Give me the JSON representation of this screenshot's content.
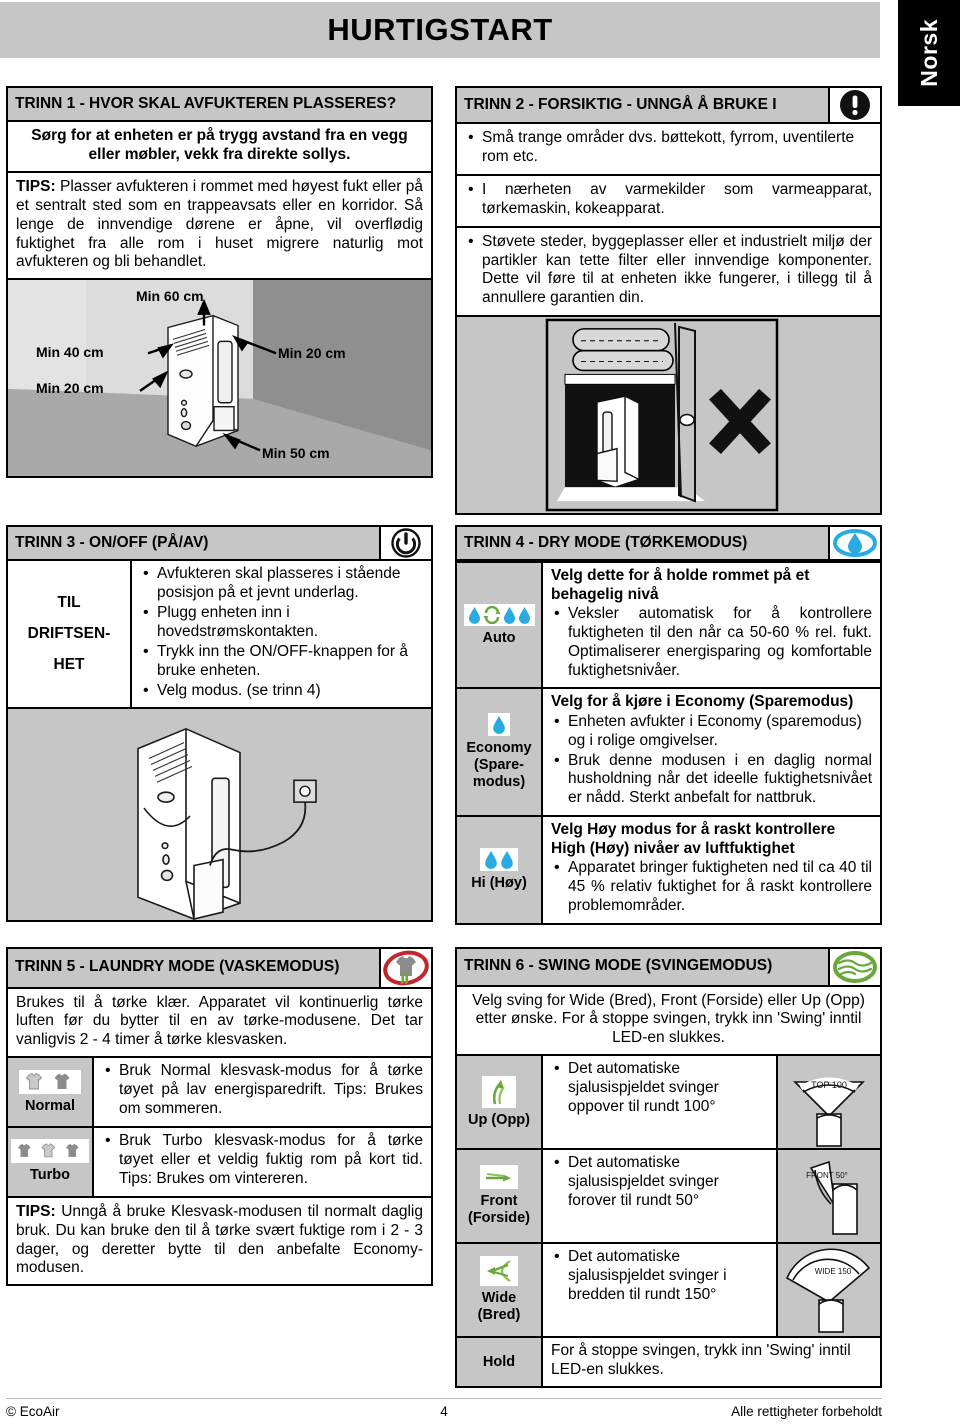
{
  "header": {
    "title": "HURTIGSTART",
    "language_tab": "Norsk"
  },
  "step1": {
    "heading": "TRINN 1 - HVOR SKAL AVFUKTEREN PLASSERES?",
    "lead": "Sørg for at enheten er på trygg avstand fra en vegg eller møbler, vekk fra direkte sollys.",
    "tips_label": "TIPS:",
    "tips_text": " Plasser avfukteren i rommet med høyest fukt eller på et sentralt sted som en trappeavsats eller en korridor. Så lenge de innvendige dørene er åpne, vil overflødig fuktighet fra alle rom i huset migrere naturlig mot avfukteren og bli behandlet.",
    "illustration_labels": {
      "top": "Min 60 cm",
      "left_upper": "Min 40 cm",
      "left_lower": "Min 20 cm",
      "right": "Min 20 cm",
      "bottom": "Min 50 cm"
    }
  },
  "step2": {
    "heading": "TRINN 2 - FORSIKTIG - UNNGÅ Å BRUKE I",
    "icon": "warning-exclamation-icon",
    "bullets": [
      "Små trange områder dvs. bøttekott, fyrrom, uventilerte rom etc.",
      "I nærheten av varmekilder som varmeapparat, tørkemaskin, kokeapparat.",
      "Støvete steder, byggeplasser eller et industrielt miljø der partikler kan tette filter eller innvendige komponenter. Dette vil føre til at enheten ikke fungerer, i tillegg til å annullere garantien din."
    ],
    "illustration_mark": "X"
  },
  "step3": {
    "heading": "TRINN 3 - ON/OFF (PÅ/AV)",
    "icon": "power-icon",
    "side_label_lines": [
      "TIL",
      "DRIFTSEN-",
      "HET"
    ],
    "bullets": [
      "Avfukteren skal plasseres i stående posisjon på et jevnt underlag.",
      "Plugg enheten inn i hovedstrømskontakten.",
      "Trykk inn the ON/OFF-knappen for å bruke enheten.",
      "Velg modus. (se trinn 4)"
    ]
  },
  "step4": {
    "heading": "TRINN 4 - DRY MODE (TØRKEMODUS)",
    "icon": "water-drop-oval-icon",
    "modes": [
      {
        "label": "Auto",
        "icon": "auto-drops-cycle-icon",
        "title": "Velg dette for å holde rommet på et behagelig nivå",
        "bullets": [
          "Veksler automatisk for å kontrollere fuktigheten til den når ca 50-60 % rel. fukt. Optimaliserer energisparing og komfortable fuktighetsnivåer."
        ]
      },
      {
        "label": "Economy (Spare-modus)",
        "icon": "single-drop-icon",
        "title": "Velg for å kjøre i Economy (Sparemodus)",
        "bullets": [
          "Enheten avfukter i Economy (sparemodus) og i rolige omgivelser.",
          "Bruk denne modusen i en daglig normal husholdning når det ideelle fuktighetsnivået er nådd. Sterkt anbefalt for nattbruk."
        ]
      },
      {
        "label": "Hi (Høy)",
        "icon": "double-drop-icon",
        "title": "Velg Høy modus for å raskt kontrollere High (Høy) nivåer av luftfuktighet",
        "bullets": [
          "Apparatet bringer fuktigheten ned til ca 40 til 45 % relativ fuktighet for å raskt kontrollere problemområder."
        ]
      }
    ]
  },
  "step5": {
    "heading": "TRINN 5 - LAUNDRY MODE (VASKEMODUS)",
    "icon": "laundry-tshirt-icon",
    "intro": "Brukes til å tørke klær. Apparatet vil kontinuerlig tørke luften før du bytter til en av tørke-modusene. Det tar vanligvis 2 - 4 timer å tørke klesvasken.",
    "modes": [
      {
        "label": "Normal",
        "icon": "two-tshirts-icon",
        "bullets": [
          "Bruk Normal klesvask-modus for å tørke tøyet på lav energisparedrift. Tips: Brukes om sommeren."
        ]
      },
      {
        "label": "Turbo",
        "icon": "three-tshirts-icon",
        "bullets": [
          "Bruk Turbo klesvask-modus for å tørke tøyet eller et veldig fuktig rom på kort tid. Tips: Brukes om vintereren."
        ]
      }
    ],
    "tips_label": "TIPS:",
    "tips_text": " Unngå å bruke Klesvask-modusen til normalt daglig bruk. Du kan bruke den til å tørke svært fuktige rom i 2 - 3 dager, og deretter bytte til den anbefalte Economy-modusen."
  },
  "step6": {
    "heading": "TRINN 6 - SWING MODE (SVINGEMODUS)",
    "icon": "swing-waves-icon",
    "intro": "Velg sving for Wide (Bred), Front (Forside) eller Up (Opp) etter ønske. For å stoppe svingen, trykk inn 'Swing' inntil LED-en slukkes.",
    "modes": [
      {
        "label": "Up (Opp)",
        "icon": "swing-up-arrow-icon",
        "bullets": [
          "Det automatiske sjalusispjeldet svinger oppover til rundt 100°"
        ],
        "diagram_label": "TOP 100"
      },
      {
        "label": "Front (Forside)",
        "icon": "swing-front-arrow-icon",
        "bullets": [
          "Det automatiske sjalusispjeldet svinger forover til rundt 50°"
        ],
        "diagram_label": "FRONT 50°"
      },
      {
        "label": "Wide (Bred)",
        "icon": "swing-wide-arrow-icon",
        "bullets": [
          "Det automatiske sjalusispjeldet svinger i bredden til rundt 150°"
        ],
        "diagram_label": "WIDE 150"
      }
    ],
    "hold": {
      "label": "Hold",
      "text": "For å stoppe svingen, trykk inn 'Swing' inntil LED-en slukkes."
    }
  },
  "footer": {
    "left": "© EcoAir",
    "center": "4",
    "right": "Alle rettigheter forbeholdt"
  },
  "colors": {
    "header_gray": "#c6c6c6",
    "drop_blue": "#29abe2",
    "swing_green": "#6aa83c",
    "laundry_red": "#c1272d",
    "shirt_gray": "#8c8c8c"
  }
}
